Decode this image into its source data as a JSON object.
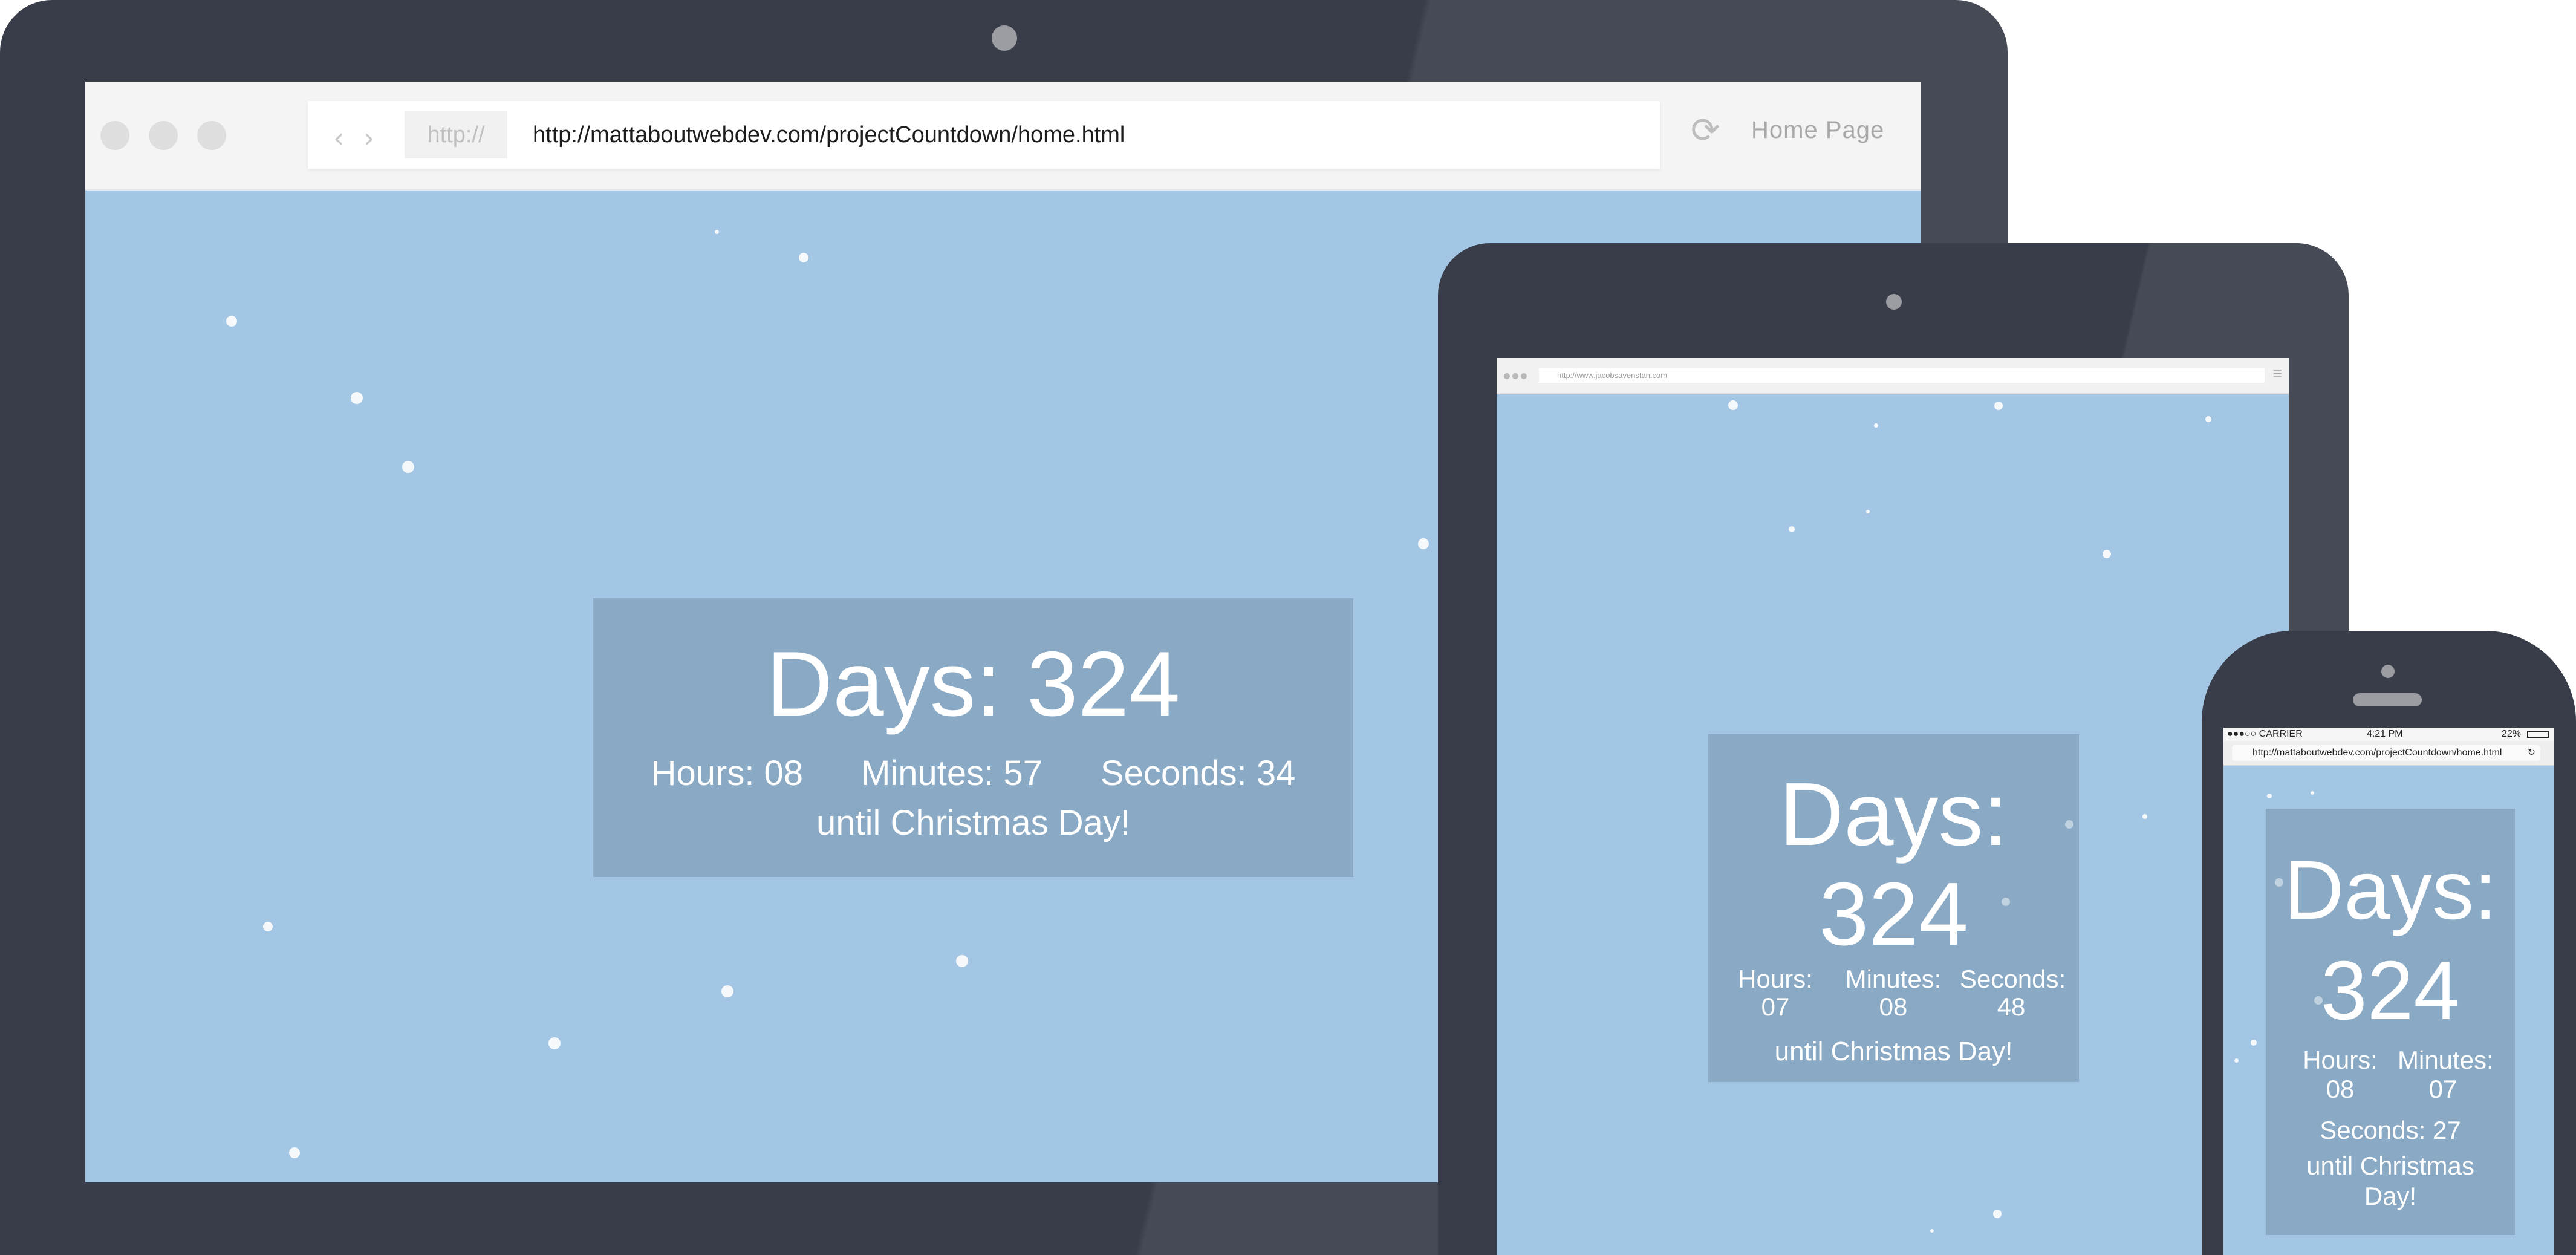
{
  "colors": {
    "frame": "#383d49",
    "screen_bg": "#a3c6e4",
    "countdown_box": "#8aa9c4",
    "text": "#ffffff"
  },
  "laptop": {
    "browser": {
      "back_icon": "chevron-left-icon",
      "forward_icon": "chevron-right-icon",
      "protocol": "http://",
      "url": "http://mattaboutwebdev.com/projectCountdown/home.html",
      "reload_icon": "reload-icon",
      "home_label": "Home Page"
    },
    "countdown": {
      "days": "Days: 324",
      "hours": "Hours: 08",
      "minutes": "Minutes: 57",
      "seconds": "Seconds: 34",
      "until": "until Christmas Day!"
    }
  },
  "tablet": {
    "browser": {
      "url": "http://www.jacobsavenstan.com",
      "menu_icon": "menu-icon"
    },
    "countdown": {
      "days": "Days: 324",
      "hours": "Hours: 07",
      "minutes": "Minutes: 08",
      "seconds": "Seconds: 48",
      "until": "until Christmas Day!"
    }
  },
  "phone": {
    "status": {
      "carrier": "●●●○○ CARRIER",
      "time": "4:21 PM",
      "battery": "22%"
    },
    "browser": {
      "url": "http://mattaboutwebdev.com/projectCountdown/home.html"
    },
    "countdown": {
      "days": "Days: 324",
      "hours": "Hours: 08",
      "minutes": "Minutes: 07",
      "seconds": "Seconds: 27",
      "until": "until Christmas Day!"
    }
  }
}
